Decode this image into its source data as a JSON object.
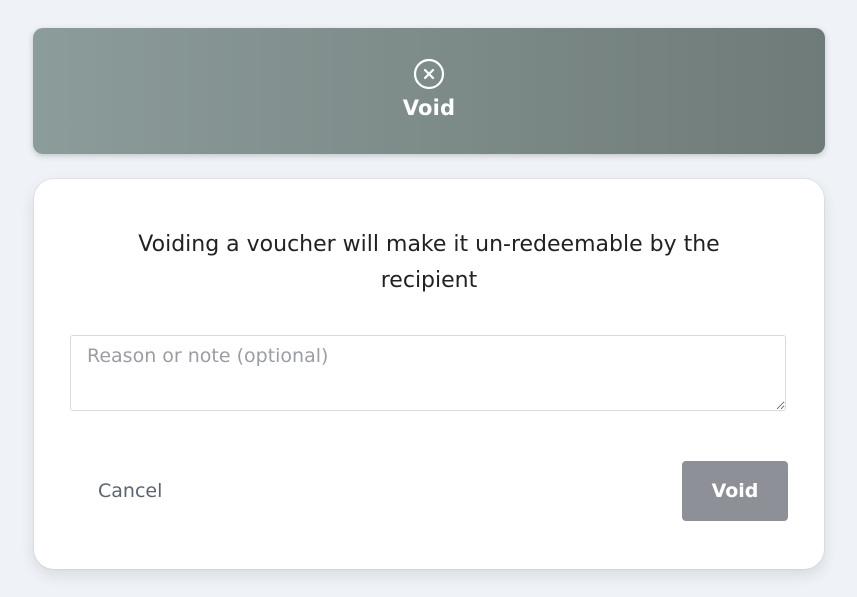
{
  "header": {
    "icon": "close-circle-icon",
    "title": "Void"
  },
  "dialog": {
    "message": "Voiding a voucher will make it un-redeemable by the recipient",
    "note": {
      "value": "",
      "placeholder": "Reason or note (optional)"
    },
    "cancel_label": "Cancel",
    "void_label": "Void"
  },
  "colors": {
    "page_background": "#eff2f7",
    "header_gradient_start": "#8c9c9b",
    "header_gradient_end": "#6f7b79",
    "void_button": "#8d9097",
    "cancel_text": "#5b6470"
  }
}
